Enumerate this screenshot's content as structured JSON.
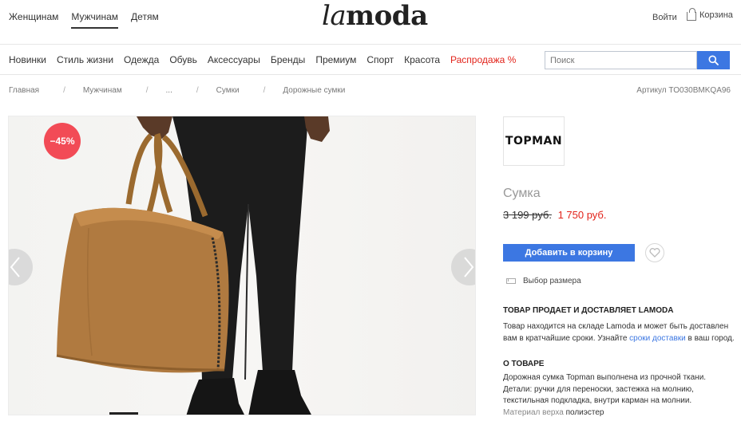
{
  "header": {
    "gender_tabs": [
      "Женщинам",
      "Мужчинам",
      "Детям"
    ],
    "active_tab": "Мужчинам",
    "logo_part1": "la",
    "logo_part2": "moda",
    "login": "Войти",
    "cart": "Корзина"
  },
  "catnav": {
    "items": [
      "Новинки",
      "Стиль жизни",
      "Одежда",
      "Обувь",
      "Аксессуары",
      "Бренды",
      "Премиум",
      "Спорт",
      "Красота",
      "Распродажа %"
    ],
    "search_placeholder": "Поиск"
  },
  "breadcrumb": {
    "items": [
      "Главная",
      "Мужчинам",
      "...",
      "Сумки",
      "Дорожные сумки"
    ],
    "separator": "/",
    "sku": "Артикул TO030BMKQA96"
  },
  "gallery": {
    "discount": "−45%"
  },
  "product": {
    "brand": "TOPMAN",
    "title": "Сумка",
    "old_price": "3 199 руб.",
    "new_price": "1 750 руб.",
    "add_to_cart": "Добавить в корзину",
    "size_choice": "Выбор размера"
  },
  "delivery": {
    "heading": "ТОВАР ПРОДАЕТ И ДОСТАВЛЯЕТ LAMODA",
    "text_before": "Товар находится на складе Lamoda и может быть доставлен вам в кратчайшие сроки. Узнайте ",
    "link": "сроки доставки",
    "text_after": " в ваш город."
  },
  "about": {
    "heading": "О ТОВАРЕ",
    "line1": "Дорожная сумка Topman выполнена из прочной ткани.",
    "line2": "Детали: ручки для переноски, застежка на молнию,",
    "line3": "текстильная подкладка, внутри карман на молнии.",
    "material_label": "Материал верха",
    "material_value": "полиэстер"
  },
  "colors": {
    "accent": "#3c77e2",
    "sale": "#e2231a",
    "discount_badge": "#f24b56"
  }
}
